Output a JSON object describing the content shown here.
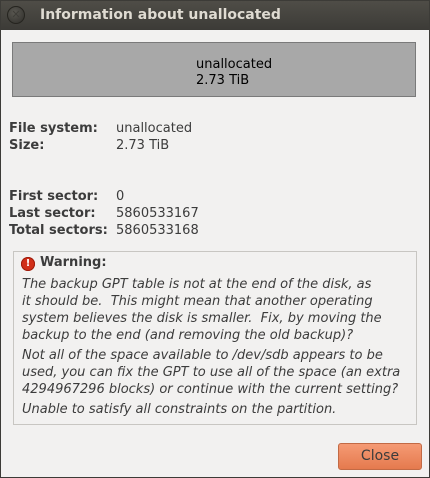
{
  "window": {
    "title": "Information about unallocated"
  },
  "partition": {
    "name": "unallocated",
    "size": "2.73 TiB"
  },
  "details": {
    "file_system_label": "File system:",
    "file_system_value": "unallocated",
    "size_label": "Size:",
    "size_value": "2.73 TiB",
    "first_sector_label": "First sector:",
    "first_sector_value": "0",
    "last_sector_label": "Last sector:",
    "last_sector_value": "5860533167",
    "total_sectors_label": "Total sectors:",
    "total_sectors_value": "5860533168"
  },
  "warning": {
    "icon": "error-icon",
    "title": "Warning:",
    "message_1": "The backup GPT table is not at the end of the disk, as\nit should be.  This might mean that another operating\nsystem believes the disk is smaller.  Fix, by moving the\nbackup to the end (and removing the old backup)?",
    "message_2": "Not all of the space available to /dev/sdb appears to be\nused, you can fix the GPT to use all of the space (an extra\n4294967296 blocks) or continue with the current setting?",
    "message_3": "Unable to satisfy all constraints on the partition."
  },
  "buttons": {
    "close_label": "Close"
  },
  "colors": {
    "titlebar": "#3c3b37",
    "partition_fill": "#a8a8a8",
    "close_button": "#e57a4e",
    "warning_icon": "#d12f19"
  }
}
